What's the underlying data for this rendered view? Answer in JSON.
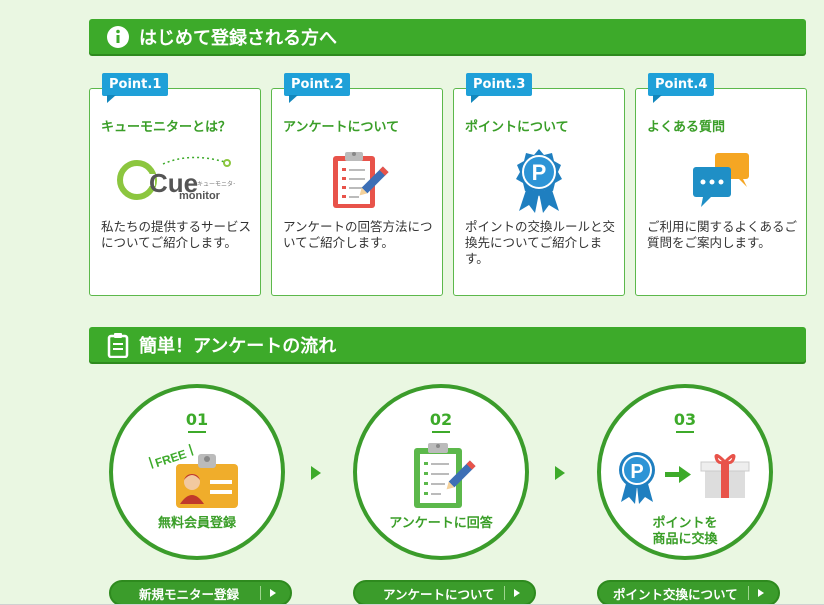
{
  "colors": {
    "accent": "#3daa2a",
    "badge": "#1fa0d8",
    "background": "#eaf7e2"
  },
  "section1": {
    "title": "はじめて登録される方へ",
    "icon": "info-icon"
  },
  "cards": [
    {
      "badge": "Point.1",
      "title": "キューモニターとは？",
      "icon": "cue-monitor-logo",
      "logo_main": "Cue",
      "logo_sub": "monitor",
      "logo_kana": "キューモニター",
      "desc": "私たちの提供するサービスについてご紹介します。"
    },
    {
      "badge": "Point.2",
      "title": "アンケートについて",
      "icon": "clipboard-pencil-icon",
      "desc": "アンケートの回答方法についてご紹介します。"
    },
    {
      "badge": "Point.3",
      "title": "ポイントについて",
      "icon": "point-medal-icon",
      "medal_letter": "P",
      "desc": "ポイントの交換ルールと交換先についてご紹介します。"
    },
    {
      "badge": "Point.4",
      "title": "よくある質問",
      "icon": "chat-bubbles-icon",
      "desc": "ご利用に関するよくあるご質問をご案内します。"
    }
  ],
  "section2": {
    "title": "簡単！アンケートの流れ",
    "icon": "clipboard-icon"
  },
  "steps": [
    {
      "number": "01",
      "label": "無料会員登録",
      "icon": "id-card-icon",
      "tag": "FREE",
      "button": "新規モニター登録"
    },
    {
      "number": "02",
      "label": "アンケートに回答",
      "icon": "clipboard-pencil-icon",
      "button": "アンケートについて"
    },
    {
      "number": "03",
      "label": "ポイントを\n商品に交換",
      "icon": "point-to-gift-icon",
      "medal_letter": "P",
      "button": "ポイント交換について"
    }
  ]
}
